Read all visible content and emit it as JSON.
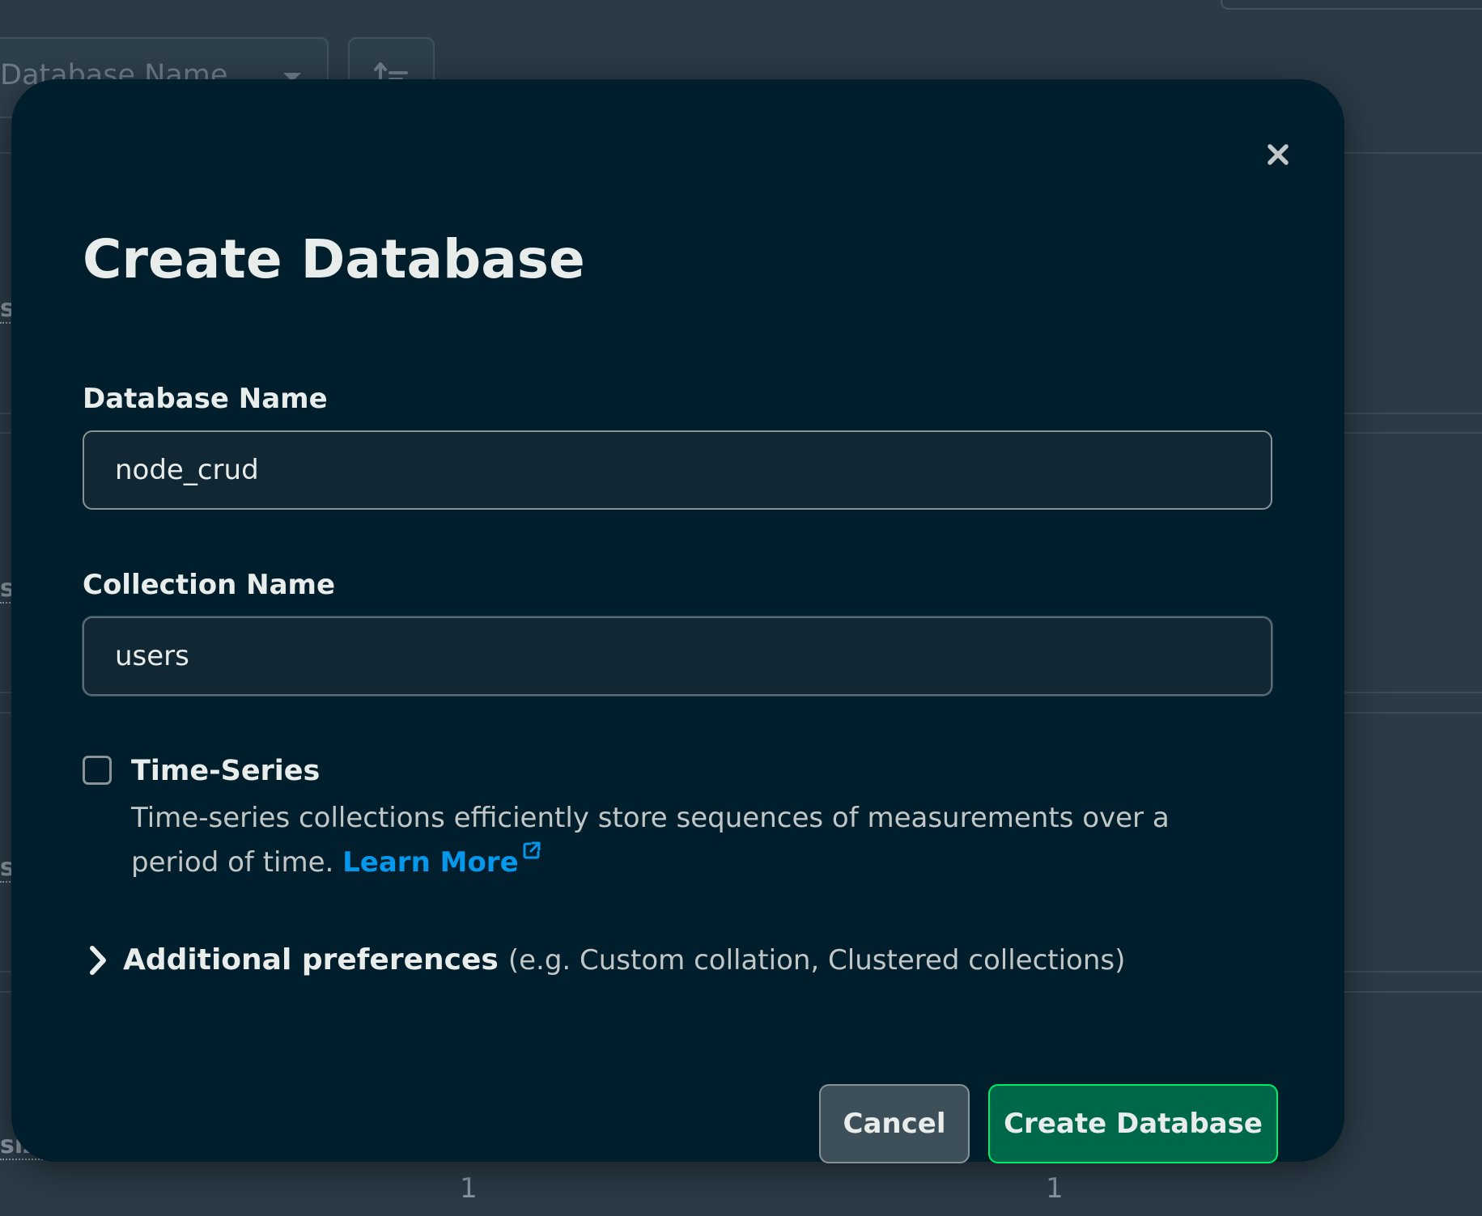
{
  "background": {
    "select_placeholder": "Database Name",
    "side_label": "si",
    "side_label_last": "size",
    "bottom_values": [
      "1",
      "1"
    ]
  },
  "modal": {
    "title": "Create Database",
    "database_name": {
      "label": "Database Name",
      "value": "node_crud"
    },
    "collection_name": {
      "label": "Collection Name",
      "value": "users"
    },
    "time_series": {
      "label": "Time-Series",
      "checked": false,
      "description": "Time-series collections efficiently store sequences of measurements over a period of time.",
      "link_label": "Learn More"
    },
    "additional_preferences": {
      "title": "Additional preferences",
      "hint": "(e.g. Custom collation, Clustered collections)"
    },
    "buttons": {
      "cancel": "Cancel",
      "create": "Create Database"
    }
  },
  "colors": {
    "modal_background": "#001e2b",
    "page_background": "#2a3b47",
    "primary_button": "#00684a",
    "primary_button_border": "#00ed64",
    "link": "#0498ec"
  },
  "icons": {
    "close": "close-icon",
    "dropdown": "caret-down-icon",
    "sort": "sort-icon",
    "external_link": "external-link-icon",
    "expand": "chevron-right-icon"
  }
}
